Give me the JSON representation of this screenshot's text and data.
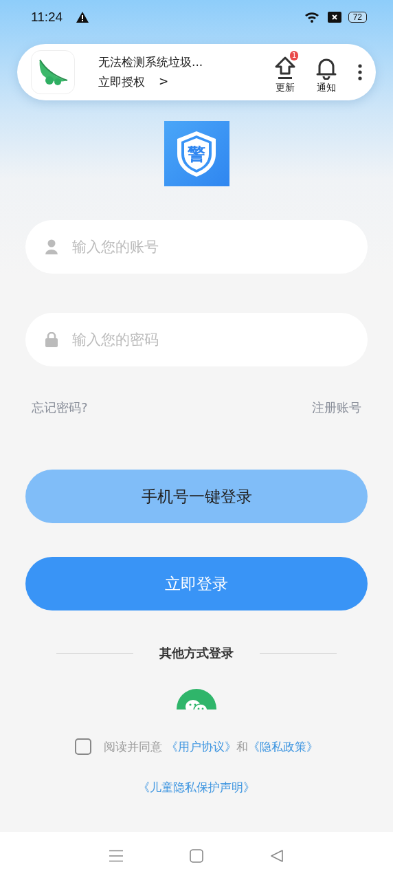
{
  "status_bar": {
    "time": "11:24",
    "battery": "72"
  },
  "notification": {
    "title": "无法检测系统垃圾...",
    "action": "立即授权",
    "action_arrow": ">",
    "actions": [
      {
        "kind": "update",
        "label": "更新",
        "badge": "1"
      },
      {
        "kind": "bell",
        "label": "通知"
      }
    ]
  },
  "logo": {
    "glyph": "警"
  },
  "fields": [
    {
      "kind": "user",
      "placeholder": "输入您的账号"
    },
    {
      "kind": "lock",
      "placeholder": "输入您的密码"
    }
  ],
  "links": [
    "忘记密码?",
    "注册账号"
  ],
  "buttons": [
    {
      "kind": "secondary",
      "label": "手机号一键登录"
    },
    {
      "kind": "primary",
      "label": "立即登录"
    }
  ],
  "other_login": {
    "title": "其他方式登录"
  },
  "agreement": {
    "checked": false,
    "text": "阅读并同意",
    "links": [
      "《用户协议》",
      "《隐私政策》"
    ],
    "joiner": "和"
  },
  "child_policy": "《儿童隐私保护声明》"
}
